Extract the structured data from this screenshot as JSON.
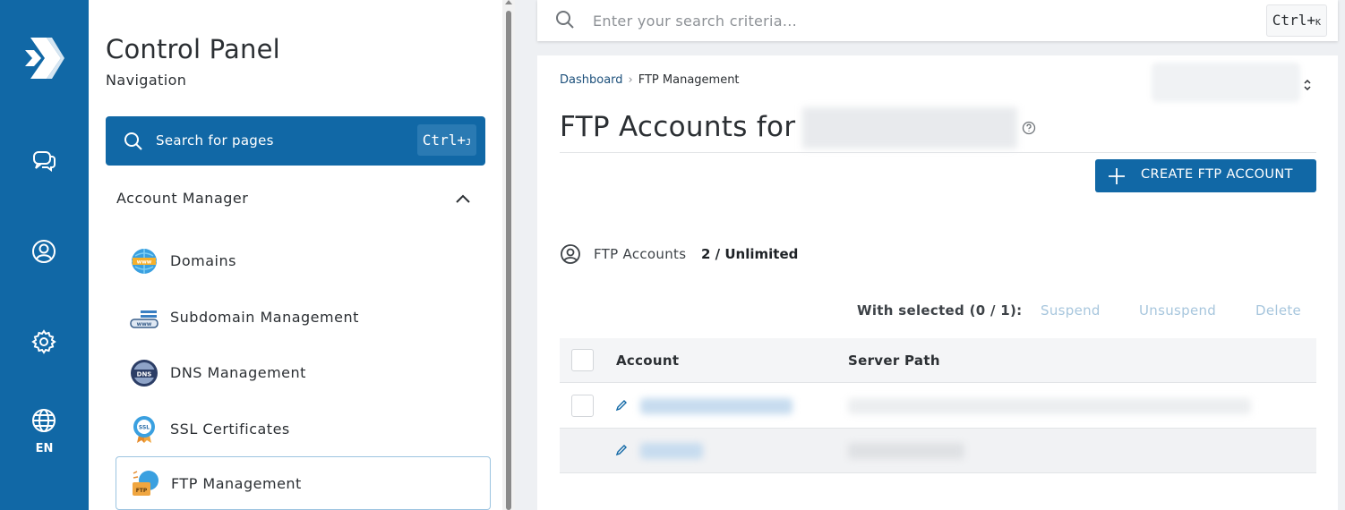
{
  "rail": {
    "language": "EN",
    "items": [
      "chat-icon",
      "user-circle-icon",
      "gear-icon",
      "globe-icon"
    ]
  },
  "nav": {
    "title": "Control Panel",
    "subtitle": "Navigation",
    "search": {
      "label": "Search for pages",
      "shortcut_main": "Ctrl+",
      "shortcut_key": "J"
    },
    "section": "Account Manager",
    "items": [
      {
        "label": "Domains",
        "icon": "www-globe-icon",
        "active": false
      },
      {
        "label": "Subdomain Management",
        "icon": "subdomain-icon",
        "active": false
      },
      {
        "label": "DNS Management",
        "icon": "dns-icon",
        "active": false
      },
      {
        "label": "SSL Certificates",
        "icon": "ssl-badge-icon",
        "active": false
      },
      {
        "label": "FTP Management",
        "icon": "ftp-folder-icon",
        "active": true
      }
    ]
  },
  "topsearch": {
    "placeholder": "Enter your search criteria...",
    "shortcut_main": "Ctrl+",
    "shortcut_key": "K"
  },
  "main": {
    "breadcrumb": [
      "Dashboard",
      "FTP Management"
    ],
    "title": "FTP Accounts for",
    "create_button": "CREATE FTP ACCOUNT",
    "usage_label": "FTP Accounts",
    "usage_value": "2 / Unlimited",
    "bulk": {
      "label": "With selected (0 / 1):",
      "actions": [
        "Suspend",
        "Unsuspend",
        "Delete"
      ]
    },
    "table": {
      "columns": [
        "Account",
        "Server Path"
      ]
    }
  },
  "colors": {
    "primary": "#1168a6",
    "disabled_action": "#a7c6dd"
  }
}
